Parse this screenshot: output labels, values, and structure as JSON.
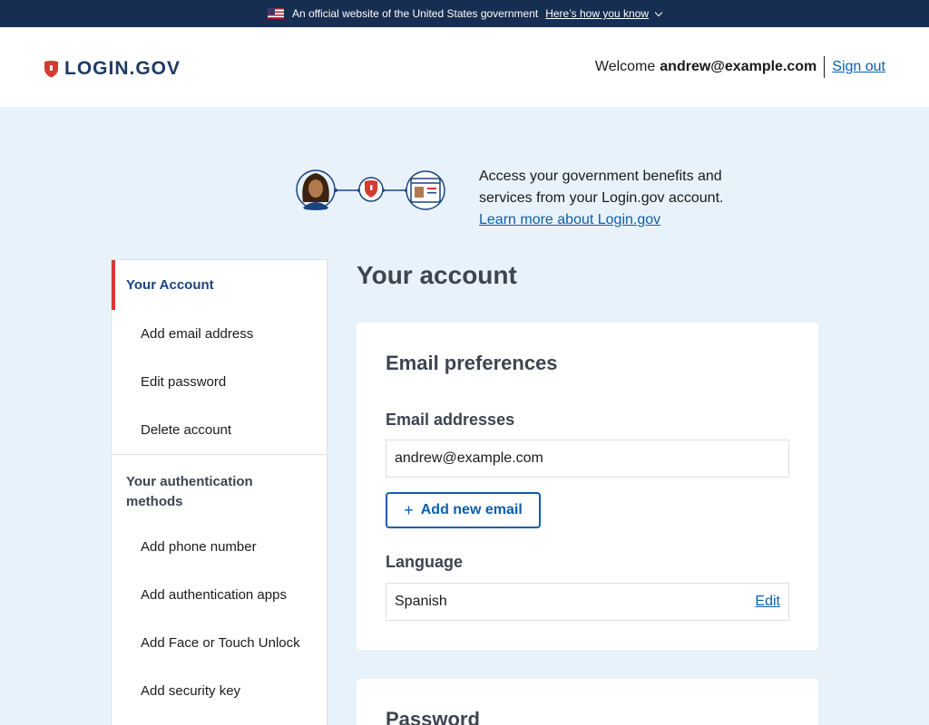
{
  "banner": {
    "text": "An official website of the United States government",
    "link": "Here’s how you know"
  },
  "header": {
    "logo": "LOGIN.GOV",
    "welcome_label": "Welcome",
    "user_email": "andrew@example.com",
    "signout": "Sign out"
  },
  "hero": {
    "line1": "Access your government benefits and",
    "line2": "services from your Login.gov account.",
    "link": "Learn more about Login.gov"
  },
  "sidebar": {
    "account_heading": "Your Account",
    "account_items": [
      "Add email address",
      "Edit password",
      "Delete account"
    ],
    "auth_heading_line1": "Your authentication",
    "auth_heading_line2": "methods",
    "auth_items": [
      "Add phone number",
      "Add authentication apps",
      "Add Face or Touch Unlock",
      "Add security key"
    ]
  },
  "main": {
    "title": "Your account",
    "email_card": {
      "title": "Email preferences",
      "email_label": "Email addresses",
      "email_value": "andrew@example.com",
      "add_button": "Add new email",
      "language_label": "Language",
      "language_value": "Spanish",
      "edit": "Edit"
    },
    "password_card": {
      "title": "Password"
    }
  },
  "colors": {
    "banner_bg": "#162e51",
    "page_bg": "#e8f2fa",
    "link": "#0b5fad",
    "accent_red": "#d83933"
  }
}
